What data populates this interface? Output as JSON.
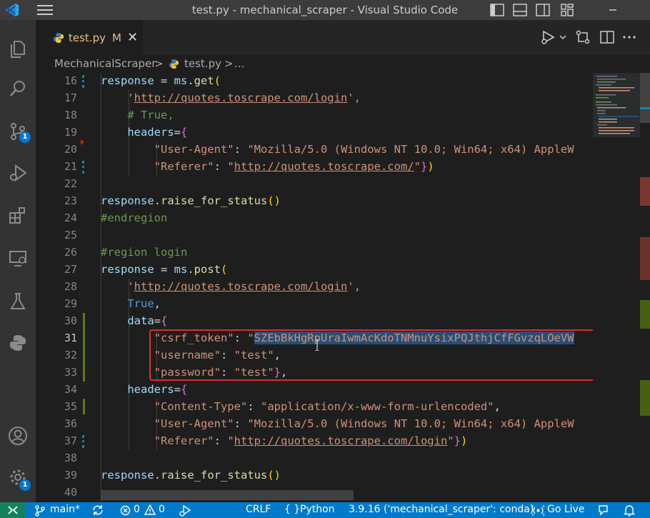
{
  "window": {
    "title": "test.py - mechanical_scraper - Visual Studio Code"
  },
  "tab": {
    "filename": "test.py",
    "modified": "M",
    "close": "✕"
  },
  "breadcrumb": {
    "folder": "MechanicalScraper",
    "sep": ">",
    "file": "test.py",
    "more": "..."
  },
  "activity": {
    "scm_badge": "1",
    "settings_badge": "1"
  },
  "editor": {
    "lines": [
      {
        "n": "16",
        "tokens": [
          [
            "v",
            "response"
          ],
          [
            "",
            "&nbsp;= "
          ],
          [
            "v",
            "ms"
          ],
          [
            "",
            "."
          ],
          [
            "f",
            "get"
          ],
          [
            "b",
            "("
          ]
        ]
      },
      {
        "n": "17"
      },
      {
        "n": "18"
      },
      {
        "n": "19"
      },
      {
        "n": "20"
      },
      {
        "n": "21"
      },
      {
        "n": "22"
      },
      {
        "n": "23"
      },
      {
        "n": "24"
      },
      {
        "n": "25"
      },
      {
        "n": "26"
      },
      {
        "n": "27"
      },
      {
        "n": "28"
      },
      {
        "n": "29"
      },
      {
        "n": "30"
      },
      {
        "n": "31"
      },
      {
        "n": "32"
      },
      {
        "n": "33"
      },
      {
        "n": "34"
      },
      {
        "n": "35"
      },
      {
        "n": "36"
      },
      {
        "n": "37"
      },
      {
        "n": "38"
      },
      {
        "n": "39"
      },
      {
        "n": "40"
      }
    ],
    "code": {
      "l16_var": "response",
      "l16_op": " = ",
      "l16_obj": "ms",
      "l16_fn": "get",
      "l16_paren": "(",
      "l17_q1": "'",
      "l17_url": "http://quotes.toscrape.com/login",
      "l17_q2": "',",
      "l18": "# True,",
      "l19_k": "headers",
      "l19_eq": "=",
      "l19_br": "{",
      "l20_k": "\"User-Agent\"",
      "l20_c": ": ",
      "l20_v": "\"Mozilla/5.0 (Windows NT 10.0; Win64; x64) AppleW",
      "l21_k": "\"Referer\"",
      "l21_c": ": ",
      "l21_q1": "\"",
      "l21_url": "http://quotes.toscrape.com/",
      "l21_q2": "\"",
      "l21_br": "}",
      "l21_p": ")",
      "l23_fn": "response",
      "l23_m": "raise_for_status",
      "l23_p": "()",
      "l24": "#endregion",
      "l26": "#region login",
      "l27_var": "response",
      "l27_op": " = ",
      "l27_obj": "ms",
      "l27_fn": "post",
      "l27_paren": "(",
      "l28_q1": "'",
      "l28_url": "http://quotes.toscrape.com/login",
      "l28_q2": "',",
      "l29": "True",
      "l29_c": ",",
      "l30_k": "data",
      "l30_eq": "=",
      "l30_br": "{",
      "l31_k": "\"csrf_token\"",
      "l31_c": ": ",
      "l31_q": "\"",
      "l31_v": "SZEbBkHgRpUraIwmAcKdoTNMnuYsixPQJthjCfFGvzqLOeVW",
      "l32_k": "\"username\"",
      "l32_c": ": ",
      "l32_v": "\"test\"",
      "l32_e": ",",
      "l33_k": "\"password\"",
      "l33_c": ": ",
      "l33_v": "\"test\"",
      "l33_br": "}",
      "l33_e": ",",
      "l34_k": "headers",
      "l34_eq": "=",
      "l34_br": "{",
      "l35_k": "\"Content-Type\"",
      "l35_c": ": ",
      "l35_v": "\"application/x-www-form-urlencoded\"",
      "l35_e": ",",
      "l36_k": "\"User-Agent\"",
      "l36_c": ": ",
      "l36_v": "\"Mozilla/5.0 (Windows NT 10.0; Win64; x64) AppleW",
      "l37_k": "\"Referer\"",
      "l37_c": ": ",
      "l37_q1": "\"",
      "l37_url": "http://quotes.toscrape.com/login",
      "l37_q2": "\"",
      "l37_br": "}",
      "l37_p": ")",
      "l39_fn": "response",
      "l39_m": "raise_for_status",
      "l39_p": "()"
    }
  },
  "status": {
    "branch": "main*",
    "errors": "0",
    "warnings": "0",
    "eol": "CRLF",
    "language": "Python",
    "interpreter": "3.9.16 ('mechanical_scraper': conda)",
    "golive": "Go Live"
  },
  "colors": {
    "accent": "#007acc",
    "remote": "#16825d",
    "highlight_box": "#e02b2b"
  }
}
